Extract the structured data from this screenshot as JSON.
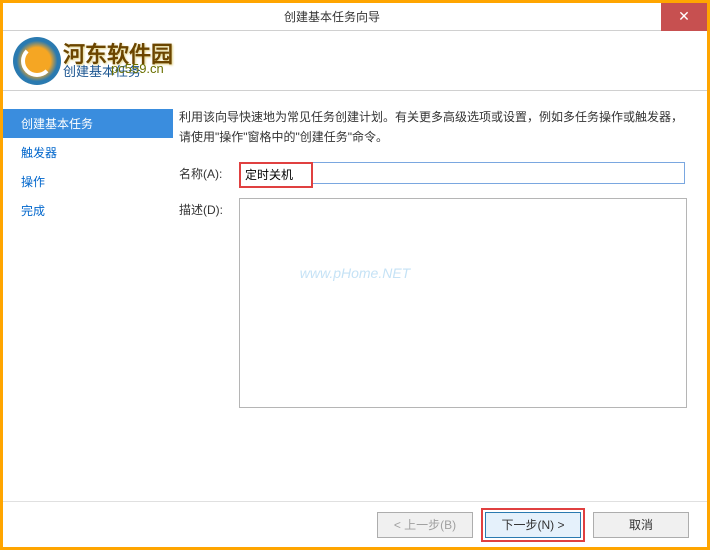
{
  "titlebar": {
    "title": "创建基本任务向导",
    "close_glyph": "✕"
  },
  "header": {
    "brand": "河东软件园",
    "subtitle": "创建基本任务",
    "brand_url": "pc559.cn"
  },
  "sidebar": {
    "items": [
      {
        "label": "创建基本任务",
        "active": true
      },
      {
        "label": "触发器",
        "active": false
      },
      {
        "label": "操作",
        "active": false
      },
      {
        "label": "完成",
        "active": false
      }
    ]
  },
  "content": {
    "instructions": "利用该向导快速地为常见任务创建计划。有关更多高级选项或设置，例如多任务操作或触发器，请使用\"操作\"窗格中的\"创建任务\"命令。",
    "name_label": "名称(A):",
    "name_value": "定时关机",
    "desc_label": "描述(D):",
    "desc_value": "",
    "watermark": "www.pHome.NET"
  },
  "footer": {
    "back": "< 上一步(B)",
    "next": "下一步(N) >",
    "cancel": "取消"
  }
}
